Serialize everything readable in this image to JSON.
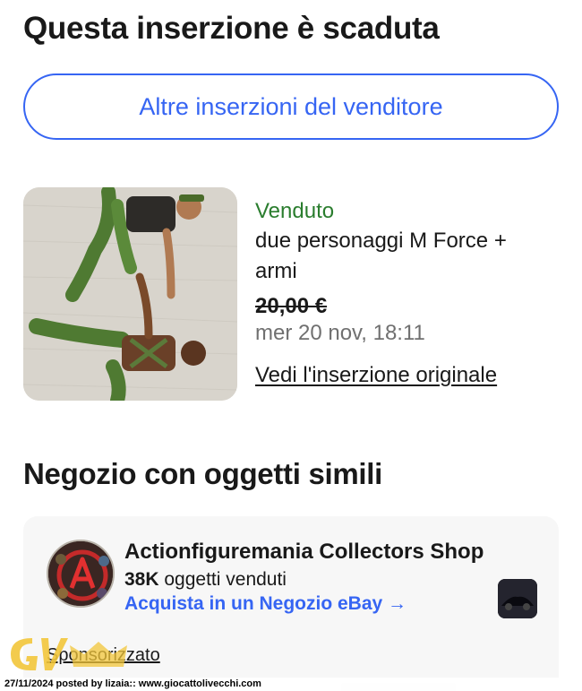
{
  "header": {
    "title": "Questa inserzione è scaduta",
    "seller_button_label": "Altre inserzioni del venditore"
  },
  "item": {
    "status": "Venduto",
    "title": "due personaggi M Force + armi",
    "price": "20,00 €",
    "date": "mer 20 nov, 18:11",
    "link_label": "Vedi l'inserzione originale"
  },
  "similar": {
    "heading": "Negozio con oggetti simili",
    "store": {
      "name": "Actionfiguremania Collectors Shop",
      "sold_count": "38K",
      "sold_label": "oggetti venduti",
      "link_label": "Acquista in un Negozio eBay →",
      "sponsored_label": "Sponsorizzato"
    }
  },
  "footer": {
    "caption": "27/11/2024 posted by lizaia:: www.giocattolivecchi.com"
  },
  "colors": {
    "accent_blue": "#3665f3",
    "sold_green": "#2a7d2e",
    "muted_gray": "#707070"
  }
}
